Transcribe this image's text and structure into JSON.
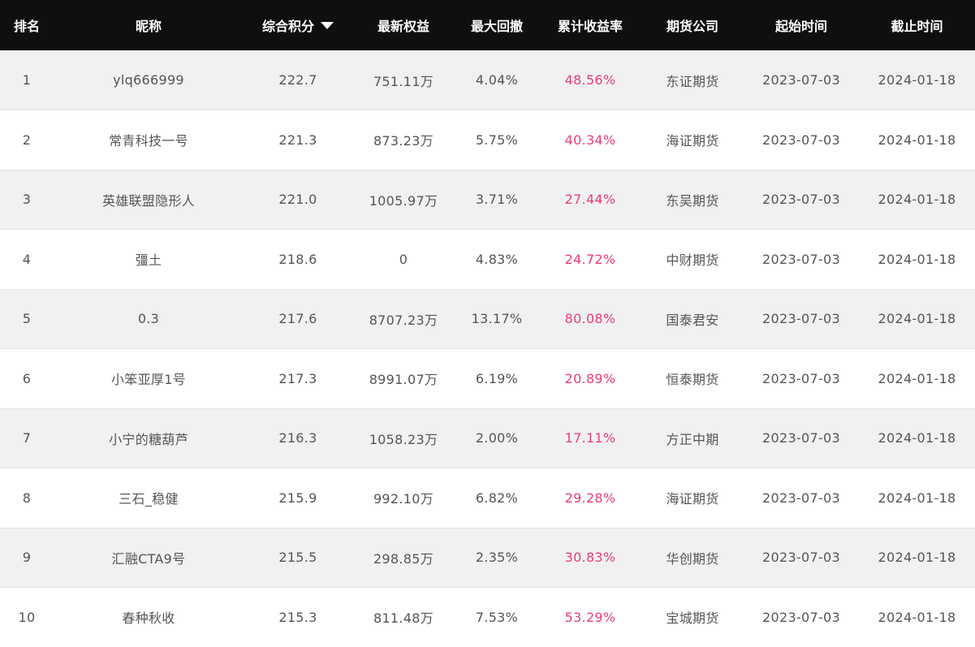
{
  "columns": {
    "rank": "排名",
    "nickname": "昵称",
    "score": "综合积分",
    "equity": "最新权益",
    "max_drawdown": "最大回撤",
    "cum_return": "累计收益率",
    "company": "期货公司",
    "start": "起始时间",
    "end": "截止时间"
  },
  "sort": {
    "column": "score",
    "direction": "desc"
  },
  "colors": {
    "header_bg": "#0f0f0f",
    "rate": "#e83e7a",
    "stripe": "#f1f1f1"
  },
  "rows": [
    {
      "rank": "1",
      "nickname": "ylq666999",
      "score": "222.7",
      "equity": "751.11万",
      "max_drawdown": "4.04%",
      "cum_return": "48.56%",
      "company": "东证期货",
      "start": "2023-07-03",
      "end": "2024-01-18"
    },
    {
      "rank": "2",
      "nickname": "常青科技一号",
      "score": "221.3",
      "equity": "873.23万",
      "max_drawdown": "5.75%",
      "cum_return": "40.34%",
      "company": "海证期货",
      "start": "2023-07-03",
      "end": "2024-01-18"
    },
    {
      "rank": "3",
      "nickname": "英雄联盟隐形人",
      "score": "221.0",
      "equity": "1005.97万",
      "max_drawdown": "3.71%",
      "cum_return": "27.44%",
      "company": "东吴期货",
      "start": "2023-07-03",
      "end": "2024-01-18"
    },
    {
      "rank": "4",
      "nickname": "彊土",
      "score": "218.6",
      "equity": "0",
      "max_drawdown": "4.83%",
      "cum_return": "24.72%",
      "company": "中财期货",
      "start": "2023-07-03",
      "end": "2024-01-18"
    },
    {
      "rank": "5",
      "nickname": "0.3",
      "score": "217.6",
      "equity": "8707.23万",
      "max_drawdown": "13.17%",
      "cum_return": "80.08%",
      "company": "国泰君安",
      "start": "2023-07-03",
      "end": "2024-01-18"
    },
    {
      "rank": "6",
      "nickname": "小笨亚厚1号",
      "score": "217.3",
      "equity": "8991.07万",
      "max_drawdown": "6.19%",
      "cum_return": "20.89%",
      "company": "恒泰期货",
      "start": "2023-07-03",
      "end": "2024-01-18"
    },
    {
      "rank": "7",
      "nickname": "小宁的糖葫芦",
      "score": "216.3",
      "equity": "1058.23万",
      "max_drawdown": "2.00%",
      "cum_return": "17.11%",
      "company": "方正中期",
      "start": "2023-07-03",
      "end": "2024-01-18"
    },
    {
      "rank": "8",
      "nickname": "三石_稳健",
      "score": "215.9",
      "equity": "992.10万",
      "max_drawdown": "6.82%",
      "cum_return": "29.28%",
      "company": "海证期货",
      "start": "2023-07-03",
      "end": "2024-01-18"
    },
    {
      "rank": "9",
      "nickname": "汇融CTA9号",
      "score": "215.5",
      "equity": "298.85万",
      "max_drawdown": "2.35%",
      "cum_return": "30.83%",
      "company": "华创期货",
      "start": "2023-07-03",
      "end": "2024-01-18"
    },
    {
      "rank": "10",
      "nickname": "春种秋收",
      "score": "215.3",
      "equity": "811.48万",
      "max_drawdown": "7.53%",
      "cum_return": "53.29%",
      "company": "宝城期货",
      "start": "2023-07-03",
      "end": "2024-01-18"
    }
  ]
}
